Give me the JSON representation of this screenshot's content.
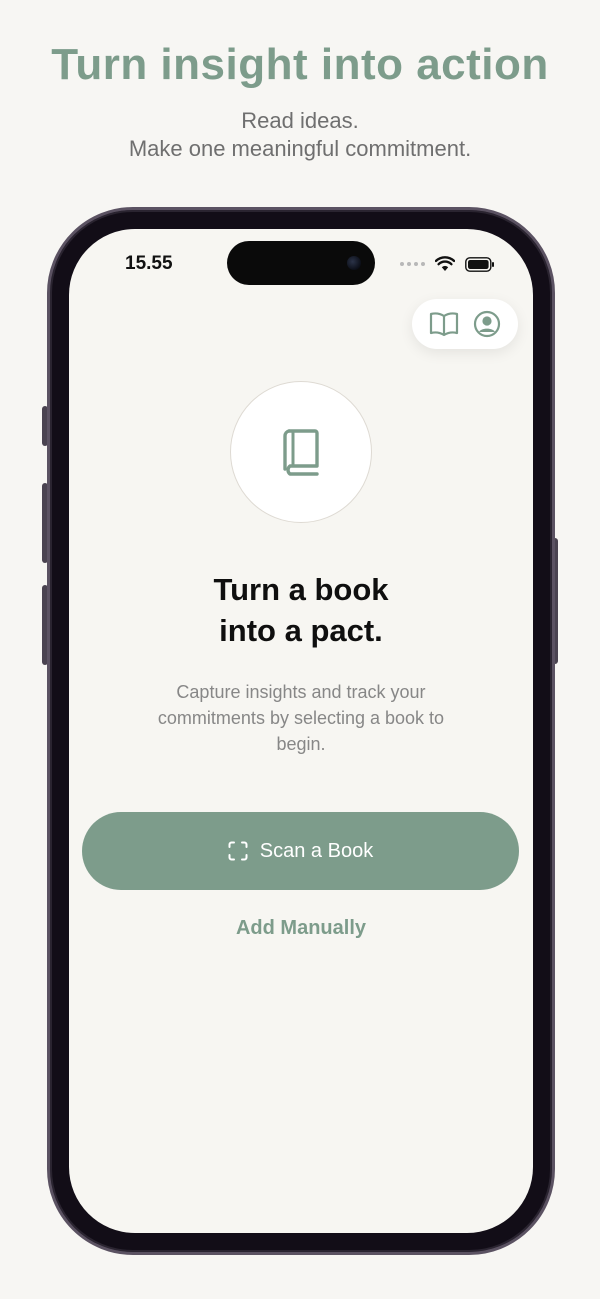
{
  "marketing": {
    "headline": "Turn insight into action",
    "subline_1": "Read ideas.",
    "subline_2": "Make one meaningful commitment."
  },
  "status_bar": {
    "time": "15.55"
  },
  "top_actions": {
    "icons": [
      "open-book-icon",
      "profile-icon"
    ]
  },
  "hero": {
    "icon": "book-icon",
    "title_line_1": "Turn a book",
    "title_line_2": "into a pact.",
    "description": "Capture insights and track your commitments by selecting a book to begin."
  },
  "actions": {
    "scan_label": "Scan a Book",
    "scan_icon": "scan-frame-icon",
    "manual_label": "Add Manually"
  },
  "colors": {
    "accent": "#7d9c8b",
    "background": "#f7f6f3",
    "title_text": "#0f0f0f",
    "body_text": "#878787"
  }
}
